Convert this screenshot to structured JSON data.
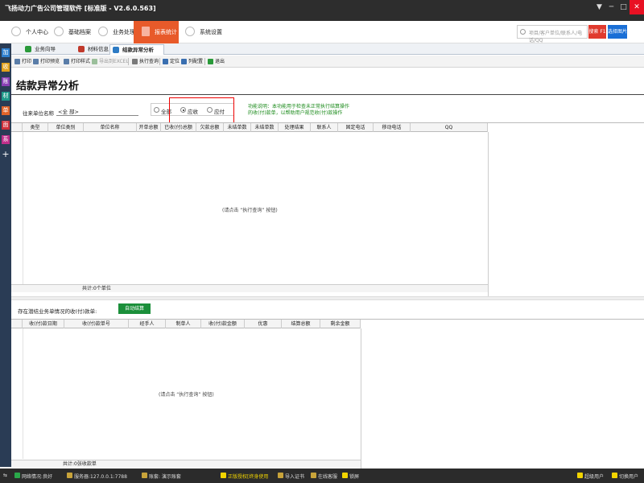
{
  "app": {
    "title": "飞扬动力广告公司管理软件 [标准版 - V2.6.0.563]",
    "window_buttons": [
      "▼",
      "─",
      "□",
      "✕"
    ]
  },
  "nav": {
    "items": [
      {
        "label": "个人中心",
        "icon": "user-icon"
      },
      {
        "label": "基础档案",
        "icon": "archive-icon"
      },
      {
        "label": "业务处理",
        "icon": "business-icon"
      },
      {
        "label": "报表统计",
        "icon": "chart-icon",
        "active": true
      },
      {
        "label": "系统设置",
        "icon": "gear-icon"
      }
    ],
    "search_placeholder": "项目/客户单位/联系人/电话/QQ",
    "search_button": "搜索 F1",
    "view_button": "选择图片"
  },
  "left_strip": [
    "加",
    "收",
    "账",
    "材",
    "单",
    "面",
    "系",
    "+"
  ],
  "tabs": [
    {
      "label": "业务向导",
      "active": false
    },
    {
      "label": "材料信息",
      "active": false
    },
    {
      "label": "结款异常分析",
      "active": true
    }
  ],
  "toolbar": [
    {
      "label": "打印",
      "disabled": false
    },
    {
      "label": "打印预览",
      "disabled": false
    },
    {
      "label": "打印样式",
      "disabled": false
    },
    {
      "label": "导出到EXCEL",
      "disabled": true
    },
    {
      "label": "执行查询",
      "disabled": false
    },
    {
      "label": "定位",
      "disabled": false
    },
    {
      "label": "列配置",
      "disabled": false
    },
    {
      "label": "退出",
      "disabled": false
    }
  ],
  "page": {
    "title": "结款异常分析",
    "filter_label": "往来单位名称",
    "filter_value": "<全 部>",
    "radios": [
      {
        "label": "全部",
        "checked": false
      },
      {
        "label": "应收",
        "checked": true
      },
      {
        "label": "应付",
        "checked": false
      }
    ],
    "note_line1": "功能说明：本功能用于检查未正常执行结算操作",
    "note_line2": "的收(付)款单，以帮助用户规范收(付)款操作"
  },
  "grid1": {
    "columns": [
      "类型",
      "单位类别",
      "单位名称",
      "开单总额",
      "已收(付)总额",
      "欠款总额",
      "未结单数",
      "未结单数",
      "处理结果",
      "联系人",
      "固定电话",
      "移动电话",
      "QQ"
    ],
    "placeholder": "(请点击 “执行查询” 按钮)",
    "footer": "共计:0个单位"
  },
  "section2": {
    "label": "存在潜结业务单情况的收(付)款单:",
    "auto_button": "自动结算"
  },
  "grid2": {
    "columns": [
      "收(付)款日期",
      "收(付)款单号",
      "经手人",
      "制单人",
      "收(付)款金额",
      "优惠",
      "结算总额",
      "剩余金额"
    ],
    "placeholder": "(请点击 “执行查询” 按钮)",
    "footer": "共计:0张收款单"
  },
  "statusbar": {
    "network": "网络情况:良好",
    "server": "服务器:127.0.0.1:7788",
    "account": "账套: 演示账套",
    "license": "正版授权[终身使用",
    "import_cert": "导入证书",
    "online_service": "在线客服",
    "lock": "锁屏",
    "super_user": "超级用户",
    "switch_user": "切换用户"
  }
}
